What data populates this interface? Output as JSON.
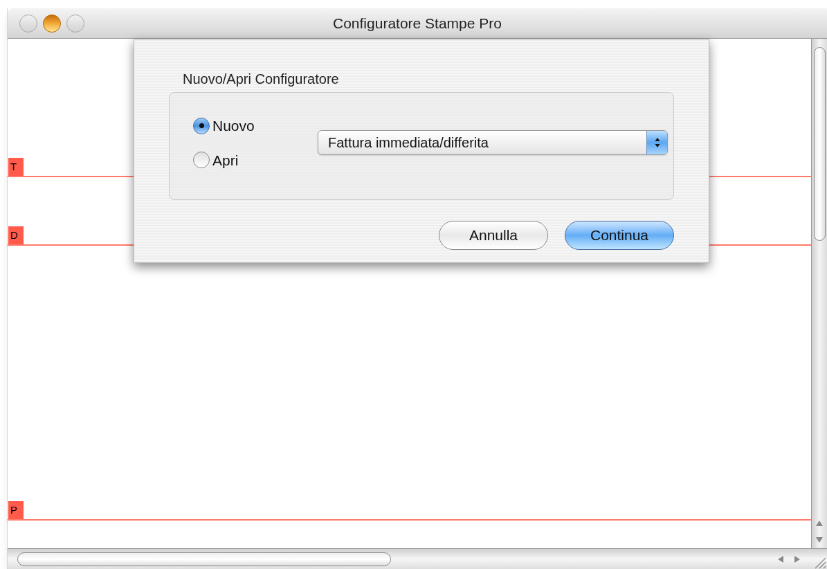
{
  "window": {
    "title": "Configuratore Stampe Pro",
    "controls": [
      {
        "kind": "close",
        "disabled": true
      },
      {
        "kind": "minimize",
        "disabled": false
      },
      {
        "kind": "zoom",
        "disabled": true
      }
    ]
  },
  "bands": [
    {
      "label": "T"
    },
    {
      "label": "D"
    },
    {
      "label": "P"
    }
  ],
  "dialog": {
    "group_title": "Nuovo/Apri Configuratore",
    "options": [
      {
        "label": "Nuovo",
        "selected": true
      },
      {
        "label": "Apri",
        "selected": false
      }
    ],
    "popup": {
      "value": "Fattura immediata/differita"
    },
    "buttons": [
      {
        "label": "Annulla",
        "default": false
      },
      {
        "label": "Continua",
        "default": true
      }
    ]
  }
}
